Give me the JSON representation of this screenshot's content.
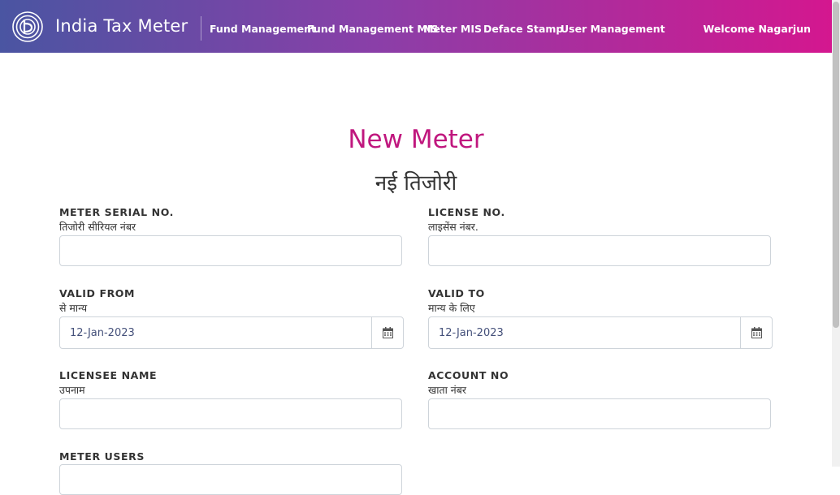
{
  "header": {
    "brand": "India Tax Meter",
    "nav": [
      {
        "label": "Fund Management"
      },
      {
        "label": "Fund Management MIS"
      },
      {
        "label": "Meter MIS"
      },
      {
        "label": "Deface Stamp"
      },
      {
        "label": "User Management"
      }
    ],
    "welcome": "Welcome Nagarjun"
  },
  "page": {
    "title_en": "New Meter",
    "title_hi": "नई तिजोरी"
  },
  "form": {
    "meter_serial": {
      "label_en": "METER SERIAL NO.",
      "label_hi": "तिजोरी सीरियल नंबर",
      "value": ""
    },
    "license_no": {
      "label_en": "LICENSE NO.",
      "label_hi": "लाइसेंस नंबर.",
      "value": ""
    },
    "valid_from": {
      "label_en": "VALID FROM",
      "label_hi": "से मान्य",
      "value": "12-Jan-2023"
    },
    "valid_to": {
      "label_en": "VALID TO",
      "label_hi": "मान्य के लिए",
      "value": "12-Jan-2023"
    },
    "licensee_name": {
      "label_en": "LICENSEE NAME",
      "label_hi": "उपनाम",
      "value": ""
    },
    "account_no": {
      "label_en": "ACCOUNT NO",
      "label_hi": "खाता नंबर",
      "value": ""
    },
    "meter_users": {
      "label_en": "METER USERS"
    }
  },
  "icons": {
    "logo": "brand-logo-icon",
    "calendar": "calendar-icon"
  },
  "colors": {
    "gradient_start": "#4a55a2",
    "gradient_end": "#d4178f",
    "title_accent": "#c0177e"
  }
}
